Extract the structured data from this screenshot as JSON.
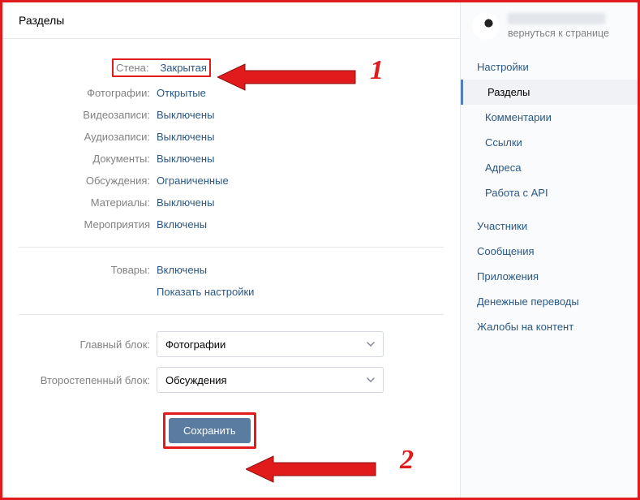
{
  "page": {
    "title": "Разделы"
  },
  "settings": {
    "wall": {
      "label": "Стена:",
      "value": "Закрытая"
    },
    "photos": {
      "label": "Фотографии:",
      "value": "Открытые"
    },
    "videos": {
      "label": "Видеозаписи:",
      "value": "Выключены"
    },
    "audio": {
      "label": "Аудиозаписи:",
      "value": "Выключены"
    },
    "docs": {
      "label": "Документы:",
      "value": "Выключены"
    },
    "discussions": {
      "label": "Обсуждения:",
      "value": "Ограниченные"
    },
    "materials": {
      "label": "Материалы:",
      "value": "Выключены"
    },
    "events": {
      "label": "Мероприятия",
      "value": "Включены"
    },
    "market": {
      "label": "Товары:",
      "value": "Включены"
    },
    "market_link": {
      "label": "",
      "value": "Показать настройки"
    }
  },
  "blocks": {
    "main": {
      "label": "Главный блок:",
      "value": "Фотографии"
    },
    "secondary": {
      "label": "Второстепенный блок:",
      "value": "Обсуждения"
    }
  },
  "actions": {
    "save": "Сохранить"
  },
  "sidebar": {
    "back": "вернуться к странице",
    "items": [
      {
        "label": "Настройки",
        "sub": false,
        "active": false
      },
      {
        "label": "Разделы",
        "sub": true,
        "active": true
      },
      {
        "label": "Комментарии",
        "sub": true,
        "active": false
      },
      {
        "label": "Ссылки",
        "sub": true,
        "active": false
      },
      {
        "label": "Адреса",
        "sub": true,
        "active": false
      },
      {
        "label": "Работа с API",
        "sub": true,
        "active": false
      },
      {
        "label": "Участники",
        "sub": false,
        "active": false
      },
      {
        "label": "Сообщения",
        "sub": false,
        "active": false
      },
      {
        "label": "Приложения",
        "sub": false,
        "active": false
      },
      {
        "label": "Денежные переводы",
        "sub": false,
        "active": false
      },
      {
        "label": "Жалобы на контент",
        "sub": false,
        "active": false
      }
    ]
  },
  "annotations": {
    "num1": "1",
    "num2": "2"
  }
}
